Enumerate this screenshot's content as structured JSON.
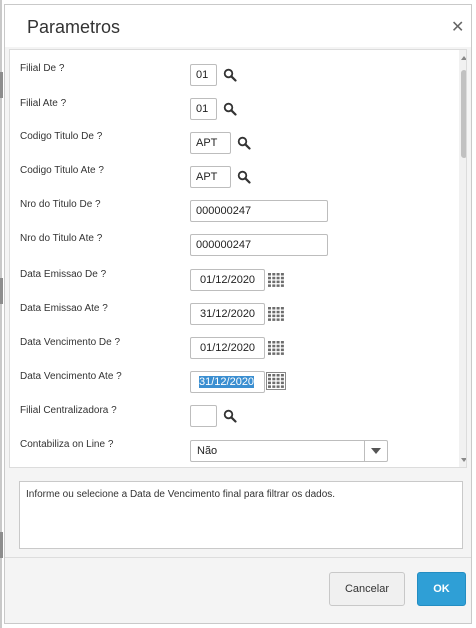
{
  "dialog": {
    "title": "Parametros",
    "close_icon": "close-icon"
  },
  "fields": [
    {
      "label": "Filial De ?",
      "value": "01"
    },
    {
      "label": "Filial Ate ?",
      "value": "01"
    },
    {
      "label": "Codigo Titulo De ?",
      "value": "APT"
    },
    {
      "label": "Codigo Titulo Ate ?",
      "value": "APT"
    },
    {
      "label": "Nro do Titulo De ?",
      "value": "000000247"
    },
    {
      "label": "Nro do Titulo Ate ?",
      "value": "000000247"
    },
    {
      "label": "Data Emissao De ?",
      "value": "01/12/2020"
    },
    {
      "label": "Data Emissao Ate ?",
      "value": "31/12/2020"
    },
    {
      "label": "Data Vencimento De ?",
      "value": "01/12/2020"
    },
    {
      "label": "Data Vencimento Ate ?",
      "value": "31/12/2020"
    },
    {
      "label": "Filial Centralizadora ?",
      "value": ""
    },
    {
      "label": "Contabiliza on Line ?",
      "value": "Não"
    }
  ],
  "help_text": "Informe ou selecione a Data de Vencimento final para filtrar os dados.",
  "buttons": {
    "cancel": "Cancelar",
    "ok": "OK"
  },
  "colors": {
    "accent": "#2f9fd6",
    "selection": "#3b8fd1"
  }
}
